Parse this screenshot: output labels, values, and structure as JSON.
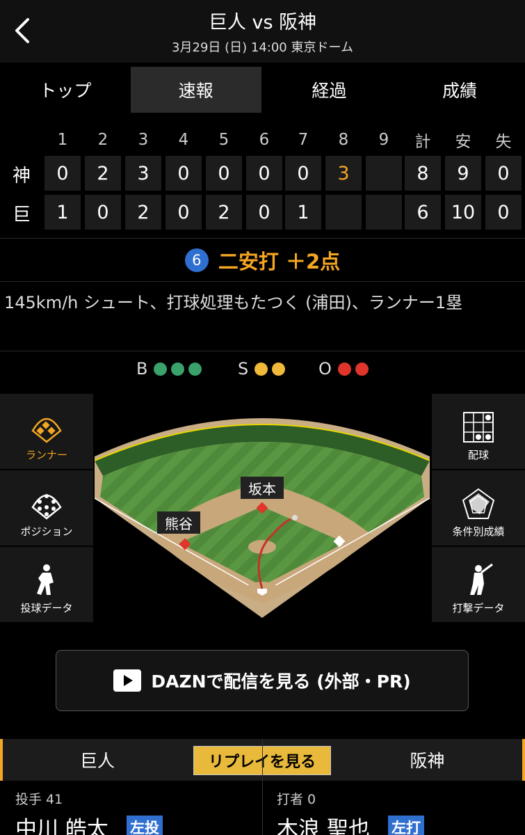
{
  "header": {
    "title": "巨人 vs 阪神",
    "subtitle": "3月29日 (日) 14:00 東京ドーム"
  },
  "tabs": [
    {
      "label": "トップ",
      "active": false
    },
    {
      "label": "速報",
      "active": true
    },
    {
      "label": "経過",
      "active": false
    },
    {
      "label": "成績",
      "active": false
    }
  ],
  "scoreboard": {
    "headers": [
      "1",
      "2",
      "3",
      "4",
      "5",
      "6",
      "7",
      "8",
      "9",
      "計",
      "安",
      "失"
    ],
    "teams": [
      {
        "label": "神",
        "scores": [
          "0",
          "2",
          "3",
          "0",
          "0",
          "0",
          "0",
          "3",
          "",
          "8",
          "9",
          "0"
        ],
        "highlight_index": 7
      },
      {
        "label": "巨",
        "scores": [
          "1",
          "0",
          "2",
          "0",
          "2",
          "0",
          "1",
          "",
          "",
          "6",
          "10",
          "0"
        ]
      }
    ]
  },
  "play": {
    "number": "6",
    "result": "二安打 ＋2点",
    "description": "145km/h シュート、打球処理もたつく (浦田)、ランナー1塁"
  },
  "count": {
    "balls_label": "B",
    "balls": 3,
    "strikes_label": "S",
    "strikes": 2,
    "outs_label": "O",
    "outs": 2,
    "ball_color": "#3aa16b",
    "strike_color": "#f0b93a",
    "out_color": "#e0352b"
  },
  "left_menu": [
    {
      "label": "ランナー",
      "icon": "diamond-runner-icon",
      "active": true
    },
    {
      "label": "ポジション",
      "icon": "position-dots-icon",
      "active": false
    },
    {
      "label": "投球データ",
      "icon": "pitcher-icon",
      "active": false
    }
  ],
  "right_menu": [
    {
      "label": "配球",
      "icon": "pitch-grid-icon"
    },
    {
      "label": "条件別成績",
      "icon": "radar-chart-icon"
    },
    {
      "label": "打撃データ",
      "icon": "batter-icon"
    }
  ],
  "field": {
    "runners": [
      {
        "name": "坂本"
      },
      {
        "name": "熊谷"
      }
    ]
  },
  "dazn": {
    "label": "DAZNで配信を見る (外部・PR)"
  },
  "bottom": {
    "left_team": "巨人",
    "replay_label": "リプレイを見る",
    "right_team": "阪神"
  },
  "pitcher": {
    "role": "投手 41",
    "name": "中川 皓太",
    "badge": "左投"
  },
  "batter": {
    "role": "打者 0",
    "name": "木浪 聖也",
    "badge": "左打"
  },
  "colors": {
    "accent": "#f5a623",
    "blue": "#2f6fd0"
  }
}
